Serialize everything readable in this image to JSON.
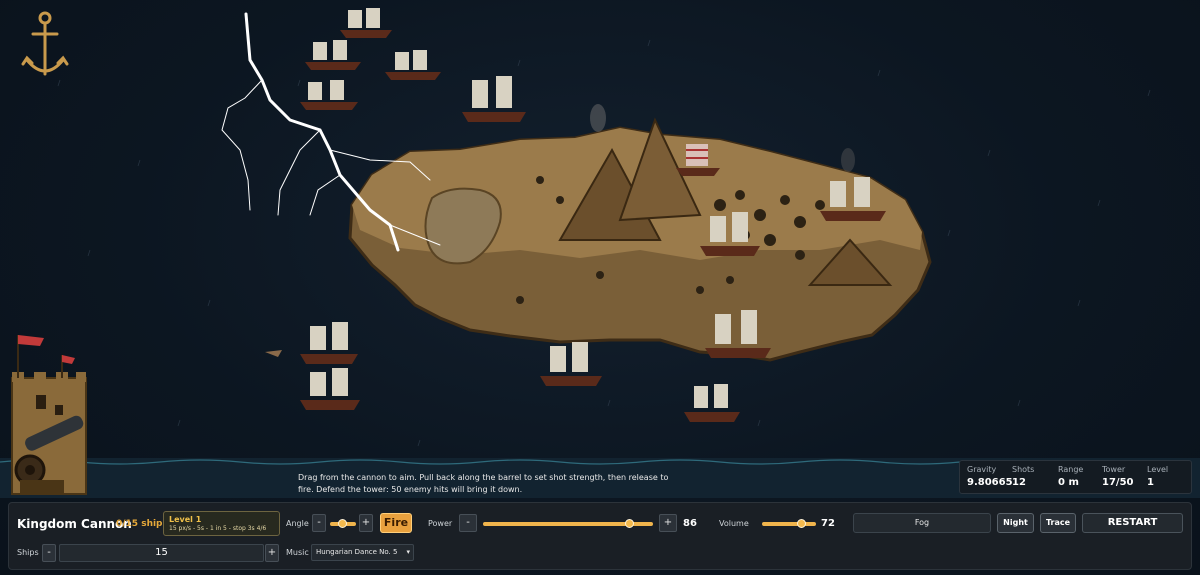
{
  "hint": "Drag from the cannon to aim. Pull back along the barrel to set shot strength, then release to fire. Defend the tower: 50 enemy hits will bring it down.",
  "stats": {
    "gravity_label": "Gravity",
    "gravity_value": "9.80665",
    "shots_label": "Shots",
    "shots_value": "12",
    "range_label": "Range",
    "range_value": "0 m",
    "tower_label": "Tower",
    "tower_value": "17/50",
    "level_label": "Level",
    "level_value": "1"
  },
  "panel": {
    "title": "Kingdom Cannon",
    "ships_count": "0/15 ships",
    "level_title": "Level 1",
    "level_detail": "15 px/s - 5s - 1 in 5 - stop 3s 4/6",
    "angle_label": "Angle",
    "angle_level": 0.45,
    "fire_label": "Fire",
    "power_label": "Power",
    "power_value": "86",
    "power_level": 0.86,
    "volume_label": "Volume",
    "volume_value": "72",
    "volume_level": 0.72,
    "fog_label": "Fog",
    "night_label": "Night",
    "trace_label": "Trace",
    "restart_label": "RESTART",
    "ships_label": "Ships",
    "ships_value": "15",
    "music_label": "Music",
    "music_value": "Hungarian Dance No. 5",
    "minus": "-",
    "plus": "+"
  },
  "colors": {
    "accent": "#e9a13e",
    "sea": "#1f4b5c",
    "island": "#8a6a3f"
  }
}
